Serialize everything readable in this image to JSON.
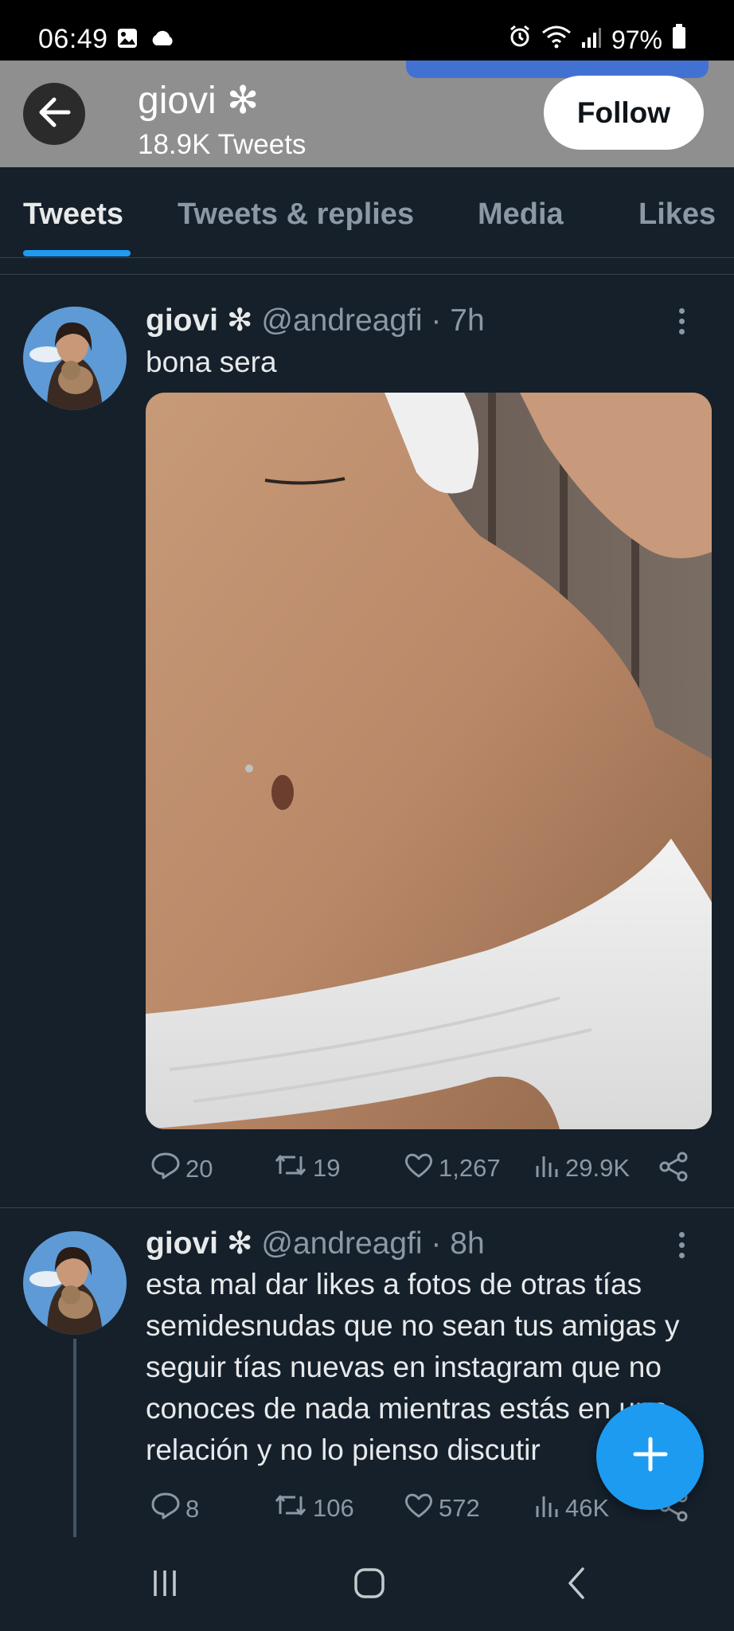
{
  "status_bar": {
    "time": "06:49",
    "battery": "97%",
    "left_icons": [
      "image-icon",
      "cloud-icon"
    ],
    "right_icons": [
      "alarm-icon",
      "wifi-icon",
      "signal-icon",
      "battery-icon"
    ]
  },
  "header": {
    "name": "giovi ✻",
    "tweet_count": "18.9K Tweets",
    "follow_label": "Follow"
  },
  "tabs": [
    {
      "label": "Tweets",
      "active": true
    },
    {
      "label": "Tweets & replies",
      "active": false
    },
    {
      "label": "Media",
      "active": false
    },
    {
      "label": "Likes",
      "active": false
    }
  ],
  "tweets": [
    {
      "name": "giovi ✻",
      "meta": "@andreagfi · 7h",
      "text": "bona sera",
      "replies": "20",
      "retweets": "19",
      "likes": "1,267",
      "views": "29.9K"
    },
    {
      "name": "giovi ✻",
      "meta": "@andreagfi · 8h",
      "text": "esta mal dar likes a fotos de otras tías semidesnudas que no sean tus amigas y seguir tías nuevas en instagram que no conoces de nada mientras estás en una relación y no lo pienso discutir",
      "replies": "8",
      "retweets": "106",
      "likes": "572",
      "views": "46K"
    }
  ],
  "colors": {
    "background": "#15202b",
    "accent": "#1d9bf0",
    "header_bg": "#8f8f8f",
    "muted_text": "#8b98a5"
  }
}
